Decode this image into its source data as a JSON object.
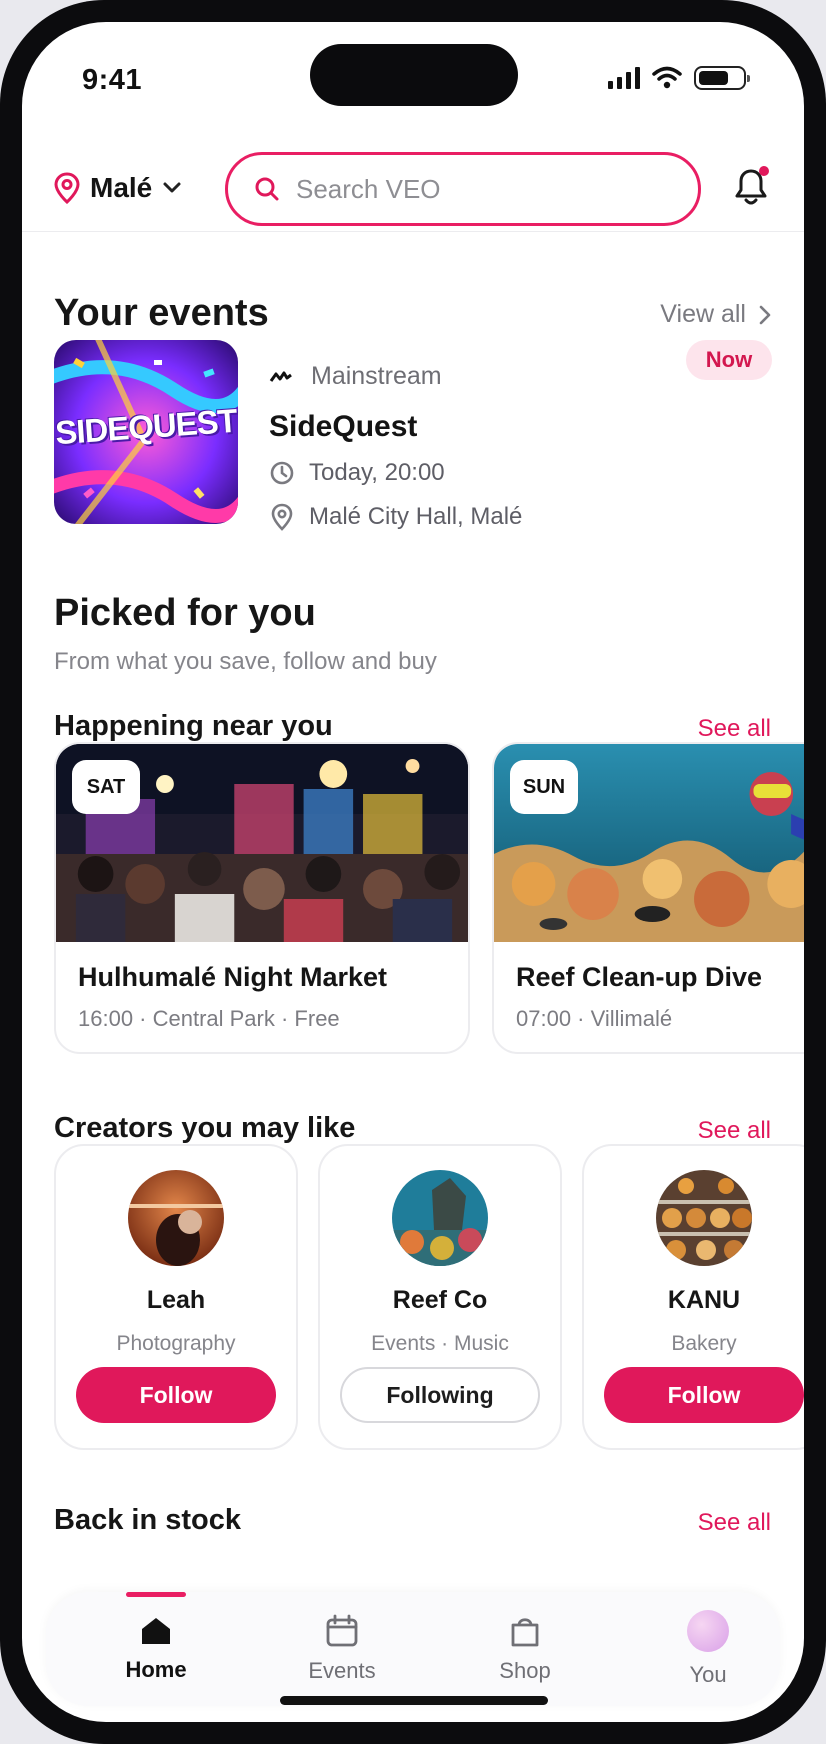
{
  "status": {
    "time": "9:41"
  },
  "header": {
    "location": "Malé",
    "search_placeholder": "Search VEO"
  },
  "your_events": {
    "title": "Your events",
    "view_all": "View all",
    "event": {
      "thumb_text": "SIDEQUEST",
      "category": "Mainstream",
      "badge": "Now",
      "name": "SideQuest",
      "time": "Today, 20:00",
      "place": "Malé City Hall, Malé"
    }
  },
  "picked": {
    "title": "Picked for you",
    "subtitle": "From what you save, follow and buy"
  },
  "near_you": {
    "title": "Happening near you",
    "see_all": "See all",
    "items": [
      {
        "day": "SAT",
        "title": "Hulhumalé Night Market",
        "sub": "16:00 · Central Park · Free"
      },
      {
        "day": "SUN",
        "title": "Reef Clean-up Dive",
        "sub": "07:00 · Villimalé"
      }
    ]
  },
  "creators": {
    "title": "Creators you may like",
    "see_all": "See all",
    "items": [
      {
        "name": "Leah",
        "category": "Photography",
        "button": "Follow",
        "following": false
      },
      {
        "name": "Reef Co",
        "category": "Events · Music",
        "button": "Following",
        "following": true
      },
      {
        "name": "KANU",
        "category": "Bakery",
        "button": "Follow",
        "following": false
      }
    ]
  },
  "back_in_stock": {
    "title": "Back in stock",
    "see_all": "See all"
  },
  "tabs": [
    {
      "label": "Home",
      "icon": "home-icon",
      "active": true
    },
    {
      "label": "Events",
      "icon": "calendar-icon",
      "active": false
    },
    {
      "label": "Shop",
      "icon": "bag-icon",
      "active": false
    },
    {
      "label": "You",
      "icon": "profile-avatar",
      "active": false
    }
  ],
  "colors": {
    "accent": "#e0185b",
    "now_badge_bg": "#fde4ec"
  }
}
